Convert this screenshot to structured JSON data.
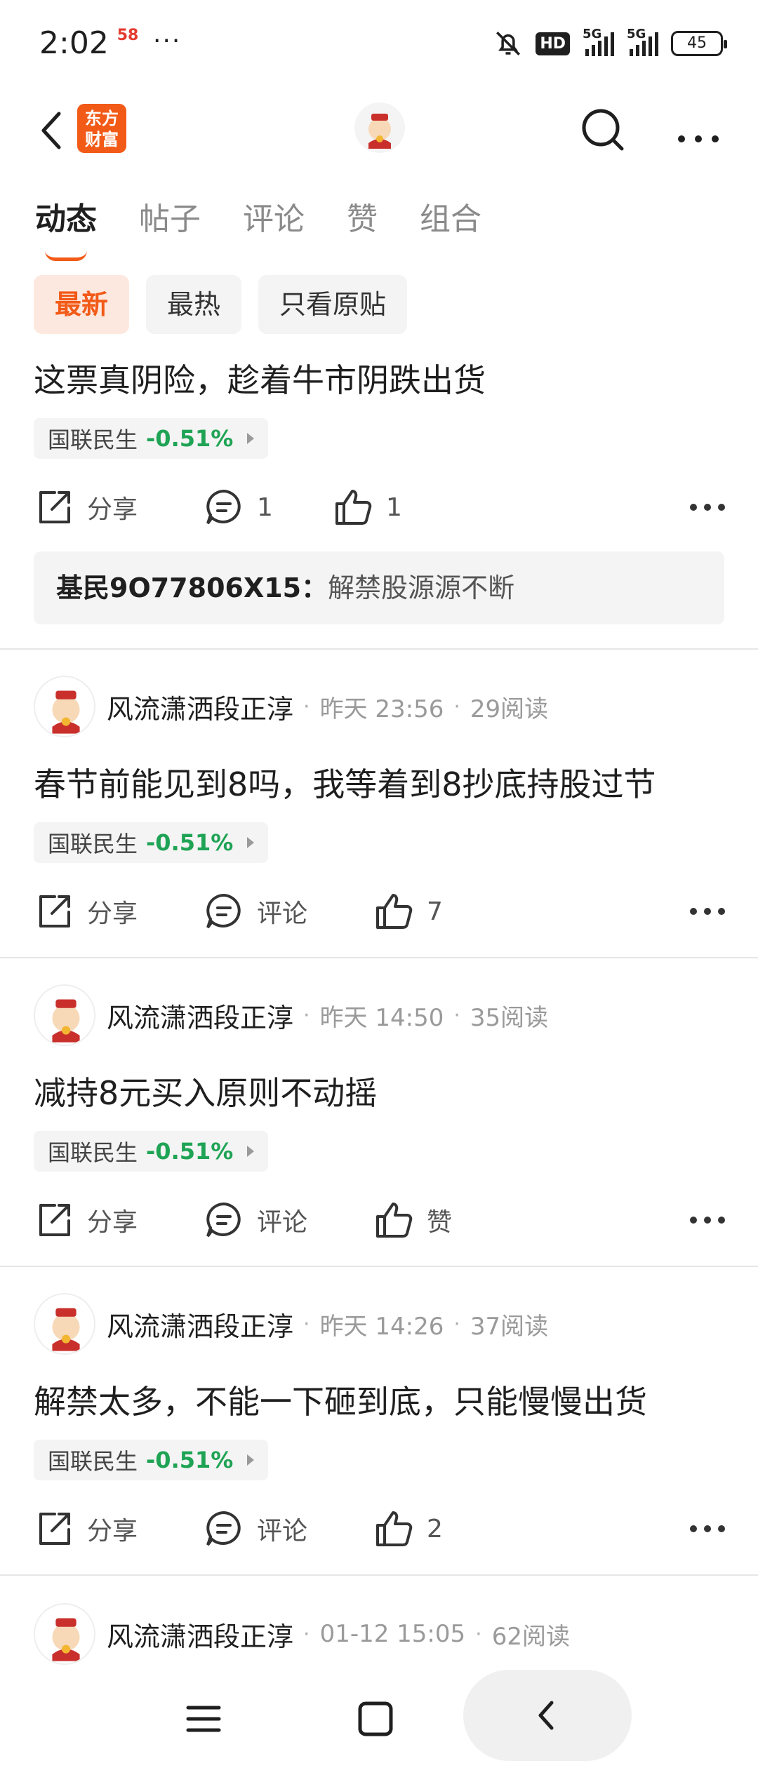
{
  "status_bar": {
    "time": "2:02",
    "badge_58": "58",
    "more": "···",
    "hd": "HD",
    "net1": "5G",
    "net2": "5G",
    "battery": "45"
  },
  "header": {
    "logo_line1": "东方",
    "logo_line2": "财富"
  },
  "tabs": [
    "动态",
    "帖子",
    "评论",
    "赞",
    "组合"
  ],
  "filters": [
    "最新",
    "最热",
    "只看原贴"
  ],
  "colors": {
    "accent": "#f25a17",
    "down_green": "#1fa355"
  },
  "posts": [
    {
      "text": "这票真阴险，趁着牛市阴跌出货",
      "stock": {
        "name": "国联民生",
        "change": "-0.51%"
      },
      "share": "分享",
      "comment": "1",
      "like": "1",
      "reply": {
        "user": "基民9O77806X15：",
        "text": "解禁股源源不断"
      }
    },
    {
      "author": "风流潇洒段正淳",
      "time": "昨天 23:56",
      "reads": "29阅读",
      "text": "春节前能见到8吗，我等着到8抄底持股过节",
      "stock": {
        "name": "国联民生",
        "change": "-0.51%"
      },
      "share": "分享",
      "comment": "评论",
      "like": "7"
    },
    {
      "author": "风流潇洒段正淳",
      "time": "昨天 14:50",
      "reads": "35阅读",
      "text": "减持8元买入原则不动摇",
      "stock": {
        "name": "国联民生",
        "change": "-0.51%"
      },
      "share": "分享",
      "comment": "评论",
      "like": "赞"
    },
    {
      "author": "风流潇洒段正淳",
      "time": "昨天 14:26",
      "reads": "37阅读",
      "text": "解禁太多，不能一下砸到底，只能慢慢出货",
      "stock": {
        "name": "国联民生",
        "change": "-0.51%"
      },
      "share": "分享",
      "comment": "评论",
      "like": "2"
    },
    {
      "author": "风流潇洒段正淳",
      "time": "01-12 15:05",
      "reads": "62阅读"
    }
  ]
}
